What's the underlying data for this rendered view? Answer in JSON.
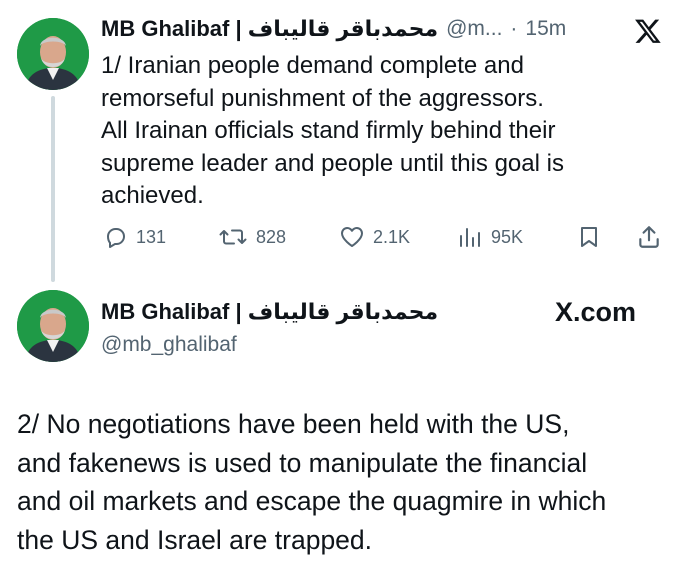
{
  "tweet1": {
    "display_name": "MB Ghalibaf | محمدباقر قالیباف",
    "handle": "@m...",
    "separator": "·",
    "time": "15m",
    "text_lines": [
      "1/ Iranian people demand complete and",
      "remorseful punishment of the aggressors.",
      "All Irainan officials stand firmly behind their",
      "supreme leader and people until this goal is",
      "achieved."
    ],
    "actions": {
      "replies": "131",
      "reposts": "828",
      "likes": "2.1K",
      "views": "95K"
    },
    "icons": [
      "avatar",
      "x-logo-icon",
      "reply-icon",
      "repost-icon",
      "like-icon",
      "views-icon",
      "bookmark-icon",
      "share-icon"
    ]
  },
  "tweet2": {
    "display_name": "MB Ghalibaf | محمدباقر قالیباف",
    "handle": "@mb_ghalibaf",
    "brand": "X.com",
    "text_lines": [
      "2/ No negotiations have been held with the US,",
      "and fakenews is used to manipulate the financial",
      "and oil markets and escape the quagmire in which",
      "the US and Israel are trapped."
    ]
  },
  "colors": {
    "text": "#0f1419",
    "secondary": "#536471",
    "thread_line": "#cfd9de",
    "avatar_bg": "#1f9a47"
  }
}
